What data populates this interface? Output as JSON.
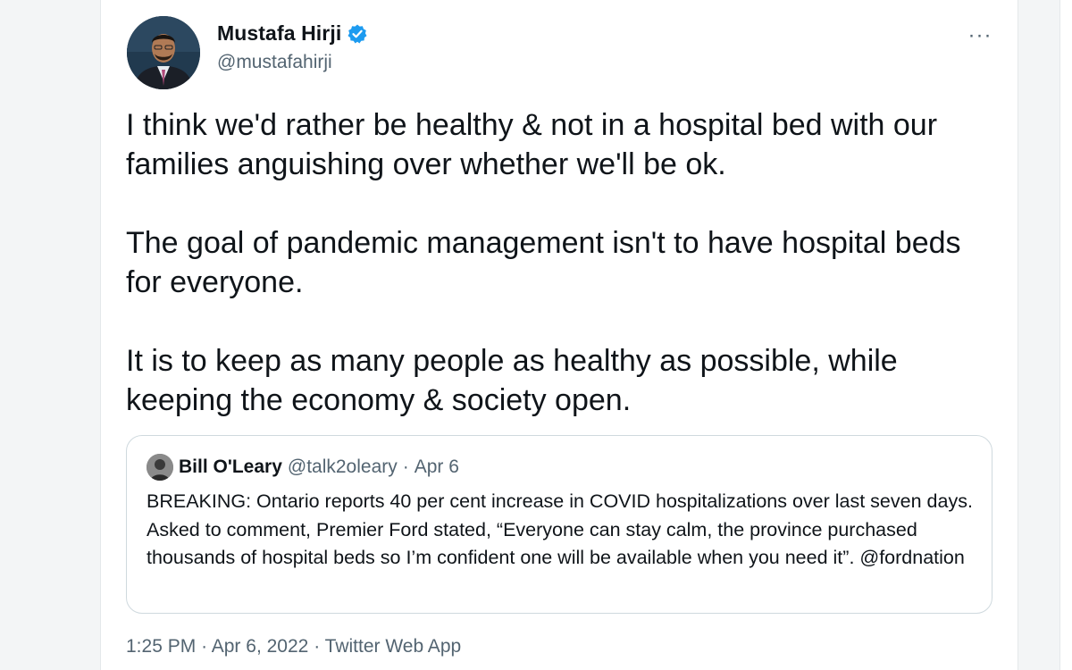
{
  "author": {
    "display_name": "Mustafa Hirji",
    "handle": "@mustafahirji",
    "verified": true,
    "avatar_icon": "profile-photo"
  },
  "more_icon": "···",
  "tweet": {
    "paragraphs": [
      "I think we'd rather be healthy & not in a hospital bed with our families anguishing over whether we'll be ok.",
      "The goal of pandemic management isn't to have hospital beds for everyone.",
      "It is to keep as many people as healthy as possible, while keeping the economy & society open."
    ]
  },
  "quote": {
    "display_name": "Bill O'Leary",
    "handle": "@talk2oleary",
    "separator": "·",
    "date": "Apr 6",
    "text": "BREAKING: Ontario reports 40 per cent increase in COVID hospitalizations over last seven days. Asked to comment, Premier Ford stated, “Everyone can stay calm, the province purchased thousands of hospital beds so I’m confident one will be available when you need it”. @fordnation"
  },
  "meta": {
    "time": "1:25 PM",
    "separator": "·",
    "date": "Apr 6, 2022",
    "source": "Twitter Web App"
  },
  "colors": {
    "verified_blue": "#1d9bf0",
    "secondary_text": "#536471",
    "border": "#cfd9de"
  }
}
